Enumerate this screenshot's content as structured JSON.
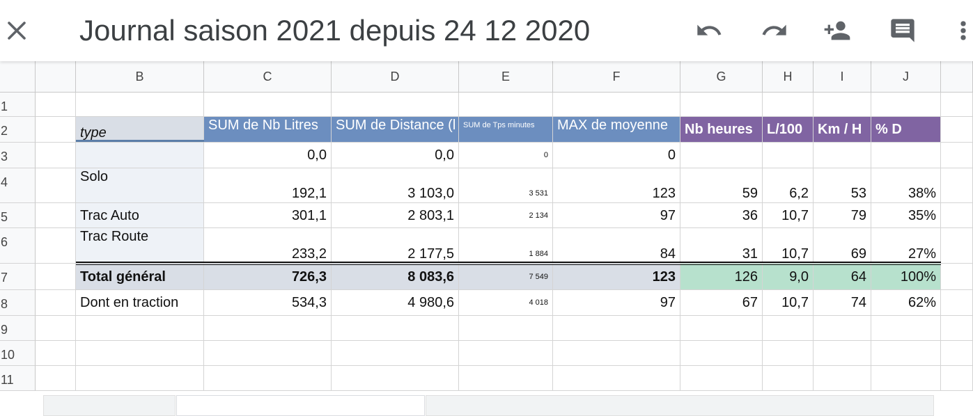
{
  "app": {
    "title": "Journal saison 2021 depuis 24 12 2020"
  },
  "toolbar": {
    "icons": [
      "close-icon",
      "undo-icon",
      "redo-icon",
      "add-person-icon",
      "comment-icon",
      "more-vert-icon"
    ]
  },
  "columns": [
    "B",
    "C",
    "D",
    "E",
    "F",
    "G",
    "H",
    "I",
    "J"
  ],
  "rows": [
    "1",
    "2",
    "3",
    "4",
    "5",
    "6",
    "7",
    "8",
    "9",
    "10",
    "11"
  ],
  "headers": {
    "type": "type",
    "c": "SUM de Nb Litres",
    "d": "SUM de Distance (l",
    "e": "SUM de Tps minutes",
    "f": "MAX de moyenne",
    "g": "Nb heures",
    "h": "L/100",
    "i": "Km / H",
    "j": "% D"
  },
  "table": {
    "r3": {
      "b": "",
      "c": "0,0",
      "d": "0,0",
      "e": "0",
      "f": "0"
    },
    "r4": {
      "b": "Solo",
      "c": "192,1",
      "d": "3 103,0",
      "e": "3 531",
      "f": "123",
      "g": "59",
      "h": "6,2",
      "i": "53",
      "j": "38%"
    },
    "r5": {
      "b": "Trac Auto",
      "c": "301,1",
      "d": "2 803,1",
      "e": "2 134",
      "f": "97",
      "g": "36",
      "h": "10,7",
      "i": "79",
      "j": "35%"
    },
    "r6": {
      "b": "Trac Route",
      "c": "233,2",
      "d": "2 177,5",
      "e": "1 884",
      "f": "84",
      "g": "31",
      "h": "10,7",
      "i": "69",
      "j": "27%"
    },
    "r7": {
      "b": "Total général",
      "c": "726,3",
      "d": "8 083,6",
      "e": "7 549",
      "f": "123",
      "g": "126",
      "h": "9,0",
      "i": "64",
      "j": "100%"
    },
    "r8": {
      "b": "Dont en traction",
      "c": "534,3",
      "d": "4 980,6",
      "e": "4 018",
      "f": "97",
      "g": "67",
      "h": "10,7",
      "i": "74",
      "j": "62%"
    }
  },
  "colors": {
    "pivot_header": "#6c8ebf",
    "calc_header": "#8064a2",
    "total_highlight": "#b7e1cd"
  }
}
